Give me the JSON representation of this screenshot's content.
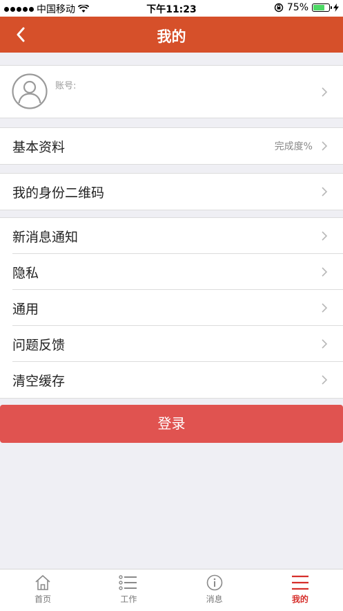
{
  "status_bar": {
    "carrier": "中国移动",
    "time": "下午11:23",
    "battery": "75%",
    "battery_level": 0.75
  },
  "nav": {
    "title": "我的",
    "back_icon": "chevron-left-icon"
  },
  "profile": {
    "account_label": "账号:"
  },
  "basic_info": {
    "label": "基本资料",
    "extra": "完成度%"
  },
  "qr_code": {
    "label": "我的身份二维码"
  },
  "settings": {
    "items": [
      {
        "label": "新消息通知"
      },
      {
        "label": "隐私"
      },
      {
        "label": "通用"
      },
      {
        "label": "问题反馈"
      },
      {
        "label": "清空缓存"
      }
    ]
  },
  "login": {
    "label": "登录"
  },
  "tabs": [
    {
      "label": "首页",
      "icon": "home-icon"
    },
    {
      "label": "工作",
      "icon": "list-icon"
    },
    {
      "label": "消息",
      "icon": "info-icon"
    },
    {
      "label": "我的",
      "icon": "menu-icon",
      "active": true
    }
  ],
  "colors": {
    "nav_bg": "#d6502a",
    "login_bg": "#e05350",
    "active_tab": "#d62f2b",
    "page_bg": "#efeff4"
  }
}
